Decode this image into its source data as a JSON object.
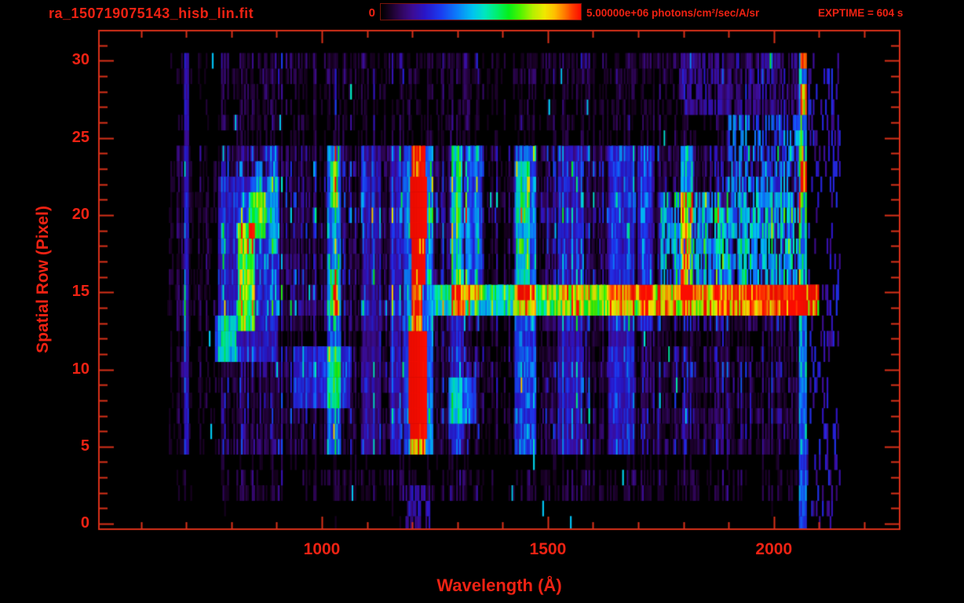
{
  "window": {
    "background": "#000000"
  },
  "colors": {
    "text_red": "#ee2213",
    "line_red": "#d93019",
    "background": "#000000"
  },
  "header": {
    "filename": "ra_150719075143_hisb_lin.fit",
    "colorbar_min": "0",
    "colorbar_max": "5.00000e+06 photons/cm²/sec/A/sr",
    "exptime": "EXPTIME = 604 s"
  },
  "chart_data": {
    "type": "heatmap",
    "title": "ra_150719075143_hisb_lin.fit",
    "xlabel": "Wavelength (Å)",
    "ylabel": "Spatial Row (Pixel)",
    "xlim": [
      505,
      2280
    ],
    "ylim": [
      -0.4,
      32
    ],
    "xticks": [
      {
        "value": 1000,
        "label": "1000"
      },
      {
        "value": 1500,
        "label": "1500"
      },
      {
        "value": 2000,
        "label": "2000"
      }
    ],
    "yticks": [
      {
        "value": 0,
        "label": "0"
      },
      {
        "value": 5,
        "label": "5"
      },
      {
        "value": 10,
        "label": "10"
      },
      {
        "value": 15,
        "label": "15"
      },
      {
        "value": 20,
        "label": "20"
      },
      {
        "value": 25,
        "label": "25"
      },
      {
        "value": 30,
        "label": "30"
      }
    ],
    "xtick_minor": {
      "start": 600,
      "end": 2200,
      "step": 100
    },
    "ytick_minor": {
      "start": 0,
      "end": 32,
      "step": 1
    },
    "colorbar": {
      "min": 0,
      "max": 5000000,
      "units": "photons/cm2/sec/A/sr"
    },
    "exposure_seconds": 604,
    "colormap": [
      [
        0.0,
        "#000000"
      ],
      [
        0.04,
        "#16011f"
      ],
      [
        0.1,
        "#31065c"
      ],
      [
        0.16,
        "#3c0d96"
      ],
      [
        0.22,
        "#2a16c8"
      ],
      [
        0.3,
        "#1b3cf0"
      ],
      [
        0.38,
        "#0c7dfa"
      ],
      [
        0.46,
        "#00c4f0"
      ],
      [
        0.52,
        "#00e7c0"
      ],
      [
        0.58,
        "#00ef70"
      ],
      [
        0.64,
        "#06ef1a"
      ],
      [
        0.7,
        "#52f400"
      ],
      [
        0.76,
        "#b4f000"
      ],
      [
        0.82,
        "#f0e800"
      ],
      [
        0.87,
        "#ffbf00"
      ],
      [
        0.92,
        "#ff7a00"
      ],
      [
        0.96,
        "#ff3c00"
      ],
      [
        1.0,
        "#fb0d00"
      ]
    ],
    "noise": {
      "seed": 150719,
      "wavelength_extent": [
        658,
        2072
      ],
      "render_extent": [
        658,
        2150
      ],
      "column_step_angstrom": 3.4,
      "bands": [
        [
          -1.0,
          1.9,
          0.018
        ],
        [
          1.9,
          3.2,
          0.085
        ],
        [
          3.2,
          4.4,
          0.04
        ],
        [
          4.4,
          12.4,
          0.16
        ],
        [
          12.4,
          24.4,
          0.22
        ],
        [
          24.4,
          28.4,
          0.08
        ],
        [
          28.4,
          30.6,
          0.12
        ],
        [
          30.6,
          32.0,
          0.0
        ]
      ],
      "row_boost": {
        "7": 1.15,
        "10": 1.25,
        "12": 0.7,
        "13": 0.9,
        "14": 1.55,
        "15": 1.25,
        "17": 0.9,
        "20": 1.3,
        "21": 1.2,
        "25": 0.8
      },
      "column_profile": [
        [
          658,
          775,
          0.45
        ],
        [
          985,
          1005,
          0.55
        ],
        [
          1358,
          1422,
          0.6
        ]
      ],
      "sparkle_chance": 0.002
    },
    "features": [
      {
        "kind": "band",
        "wl": [
          695,
          706
        ],
        "rows": [
          4.4,
          30.6
        ],
        "amp": 0.17
      },
      {
        "kind": "band",
        "wl": [
          770,
          902
        ],
        "rows": [
          11.0,
          22.6
        ],
        "amp": 0.15
      },
      {
        "kind": "band",
        "wl": [
          762,
          812
        ],
        "rows": [
          10.6,
          13.8
        ],
        "amp": 0.3
      },
      {
        "kind": "band",
        "wl": [
          815,
          852
        ],
        "rows": [
          12.3,
          19.6
        ],
        "amp": 0.42
      },
      {
        "kind": "band",
        "wl": [
          838,
          876
        ],
        "rows": [
          18.4,
          21.4
        ],
        "amp": 0.4
      },
      {
        "kind": "band",
        "wl": [
          852,
          870
        ],
        "rows": [
          21.2,
          23.6
        ],
        "amp": 0.24
      },
      {
        "kind": "band",
        "wl": [
          884,
          902
        ],
        "rows": [
          17.5,
          24.3
        ],
        "amp": 0.2
      },
      {
        "kind": "band",
        "wl": [
          938,
          1064
        ],
        "rows": [
          7.4,
          11.5
        ],
        "amp": 0.2
      },
      {
        "kind": "band",
        "wl": [
          1013,
          1042
        ],
        "rows": [
          4.6,
          24.3
        ],
        "amp": 0.26
      },
      {
        "kind": "band",
        "wl": [
          1018,
          1036
        ],
        "rows": [
          13.6,
          16.4
        ],
        "amp": 0.3
      },
      {
        "kind": "band",
        "wl": [
          1018,
          1036
        ],
        "rows": [
          20.6,
          23.3
        ],
        "amp": 0.3
      },
      {
        "kind": "band",
        "wl": [
          1090,
          1130
        ],
        "rows": [
          4.6,
          24.3
        ],
        "amp": 0.1
      },
      {
        "kind": "band",
        "wl": [
          1150,
          1176
        ],
        "rows": [
          4.6,
          24.3
        ],
        "amp": 0.14
      },
      {
        "kind": "band",
        "wl": [
          1180,
          1247
        ],
        "rows": [
          4.5,
          24.3
        ],
        "amp": 0.26
      },
      {
        "kind": "band",
        "wl": [
          1196,
          1230
        ],
        "rows": [
          4.6,
          5.7
        ],
        "amp": 0.55
      },
      {
        "kind": "band",
        "wl": [
          1194,
          1232
        ],
        "rows": [
          5.7,
          6.4
        ],
        "amp": 0.8
      },
      {
        "kind": "band",
        "wl": [
          1192,
          1234
        ],
        "rows": [
          6.4,
          12.2
        ],
        "amp": 1.0
      },
      {
        "kind": "band",
        "wl": [
          1200,
          1224
        ],
        "rows": [
          12.2,
          15.6
        ],
        "amp": 0.58
      },
      {
        "kind": "band",
        "wl": [
          1198,
          1228
        ],
        "rows": [
          15.6,
          18.6
        ],
        "amp": 0.72
      },
      {
        "kind": "band",
        "wl": [
          1194,
          1232
        ],
        "rows": [
          18.6,
          22.6
        ],
        "amp": 0.93
      },
      {
        "kind": "band",
        "wl": [
          1198,
          1228
        ],
        "rows": [
          22.6,
          24.3
        ],
        "amp": 0.7
      },
      {
        "kind": "speckle",
        "wl": [
          1185,
          1238
        ],
        "rows": [
          -0.5,
          2.2
        ],
        "amp": 0.17,
        "density": 0.5
      },
      {
        "kind": "band",
        "wl": [
          1288,
          1312
        ],
        "rows": [
          13.6,
          24.3
        ],
        "amp": 0.42
      },
      {
        "kind": "band",
        "wl": [
          1288,
          1312
        ],
        "rows": [
          4.6,
          13.6
        ],
        "amp": 0.18
      },
      {
        "kind": "band",
        "wl": [
          1316,
          1354
        ],
        "rows": [
          14.5,
          24.3
        ],
        "amp": 0.24
      },
      {
        "kind": "band",
        "wl": [
          1280,
          1342
        ],
        "rows": [
          6.6,
          9.5
        ],
        "amp": 0.24
      },
      {
        "kind": "band",
        "wl": [
          1425,
          1474
        ],
        "rows": [
          4.6,
          24.3
        ],
        "amp": 0.23
      },
      {
        "kind": "band",
        "wl": [
          1430,
          1462
        ],
        "rows": [
          15.0,
          23.2
        ],
        "amp": 0.18
      },
      {
        "kind": "band",
        "wl": [
          1520,
          1576
        ],
        "rows": [
          4.6,
          24.3
        ],
        "amp": 0.13
      },
      {
        "kind": "band",
        "wl": [
          1635,
          1692
        ],
        "rows": [
          4.6,
          24.3
        ],
        "amp": 0.16
      },
      {
        "kind": "band",
        "wl": [
          1700,
          1732
        ],
        "rows": [
          12.5,
          24.3
        ],
        "amp": 0.15
      },
      {
        "kind": "ramp",
        "wl": [
          1247,
          2064
        ],
        "rows": [
          14.9,
          15.9
        ],
        "amp": [
          0.44,
          1.0
        ]
      },
      {
        "kind": "ramp",
        "wl": [
          1247,
          2064
        ],
        "rows": [
          13.9,
          14.7
        ],
        "amp": [
          0.36,
          0.92
        ]
      },
      {
        "kind": "speckle",
        "wl": [
          1750,
          2064
        ],
        "rows": [
          15.8,
          21.6
        ],
        "amp": 0.36,
        "density": 0.75
      },
      {
        "kind": "speckle",
        "wl": [
          1900,
          2064
        ],
        "rows": [
          21.6,
          26.2
        ],
        "amp": 0.3,
        "density": 0.6
      },
      {
        "kind": "speckle",
        "wl": [
          1790,
          2064
        ],
        "rows": [
          26.2,
          30.6
        ],
        "amp": 0.12,
        "density": 0.6
      },
      {
        "kind": "band",
        "wl": [
          1795,
          1820
        ],
        "rows": [
          14.5,
          24.3
        ],
        "amp": 0.32
      },
      {
        "kind": "band",
        "wl": [
          2054,
          2072
        ],
        "rows": [
          -0.5,
          30.6
        ],
        "amp": 0.28
      },
      {
        "kind": "band",
        "wl": [
          2058,
          2072
        ],
        "rows": [
          26.4,
          28.3
        ],
        "amp": 0.55
      },
      {
        "kind": "band",
        "wl": [
          2058,
          2072
        ],
        "rows": [
          21.4,
          23.3
        ],
        "amp": 0.5
      },
      {
        "kind": "band",
        "wl": [
          2058,
          2072
        ],
        "rows": [
          29.4,
          30.6
        ],
        "amp": 0.5
      },
      {
        "kind": "band",
        "wl": [
          2062,
          2098
        ],
        "rows": [
          13.2,
          15.8
        ],
        "amp": 0.88
      },
      {
        "kind": "speckle",
        "wl": [
          2072,
          2148
        ],
        "rows": [
          -0.5,
          30.6
        ],
        "amp": 0.2,
        "density": 0.2
      }
    ]
  }
}
